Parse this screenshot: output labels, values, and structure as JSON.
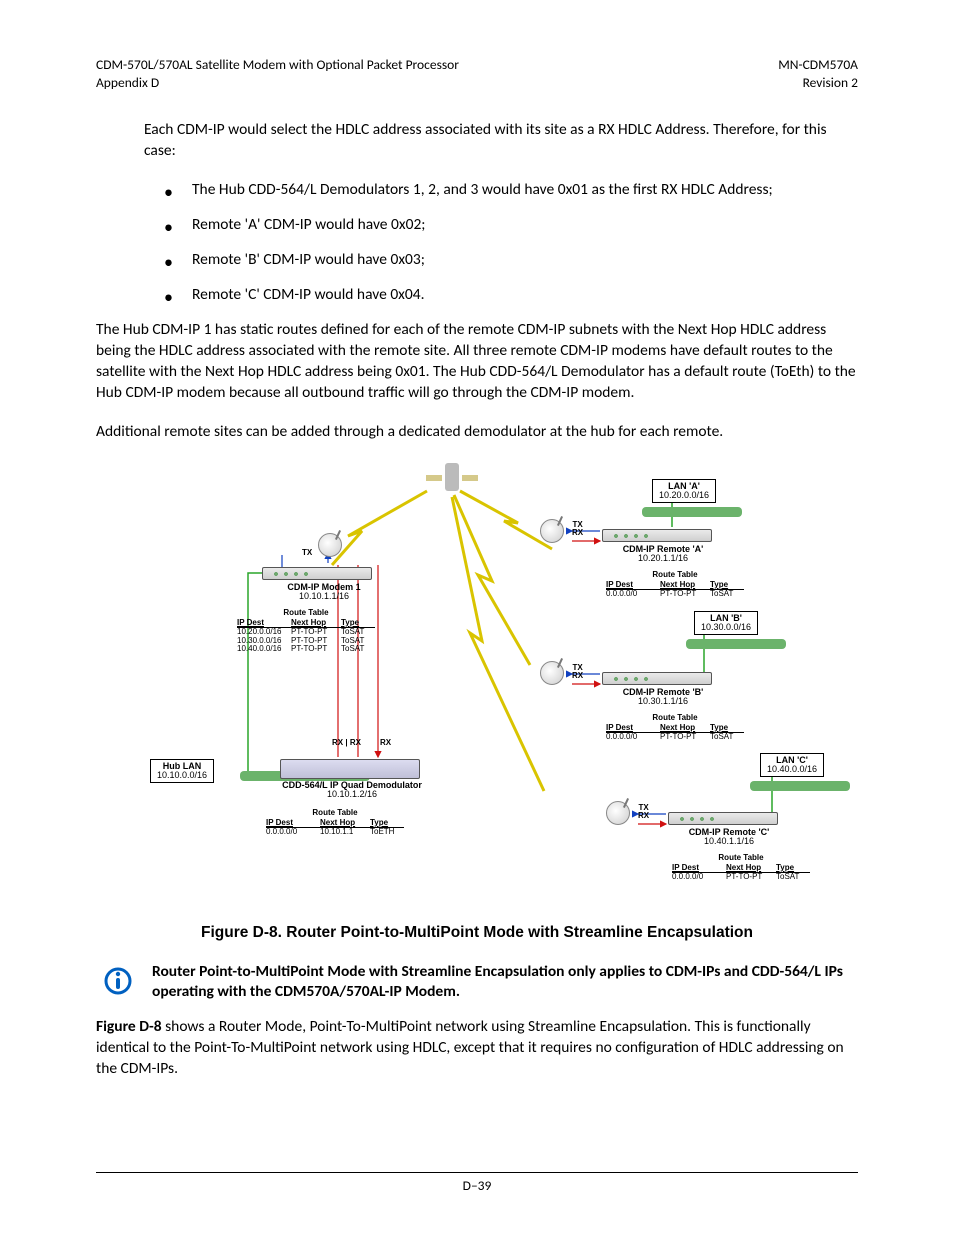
{
  "header": {
    "left1": "CDM-570L/570AL Satellite Modem with Optional Packet Processor",
    "left2": "Appendix D",
    "right1": "MN-CDM570A",
    "right2": "Revision 2"
  },
  "intro": "Each CDM-IP would select the HDLC address associated with its site as a RX HDLC Address. Therefore, for this case:",
  "bullets": [
    "The Hub CDD-564/L Demodulators 1, 2, and 3 would have 0x01 as the first RX HDLC Address;",
    "Remote 'A' CDM-IP would have 0x02;",
    "Remote 'B' CDM-IP would have 0x03;",
    "Remote 'C' CDM-IP would have 0x04."
  ],
  "para2": "The Hub CDM-IP 1 has static routes defined for each of the remote CDM-IP subnets with the Next Hop HDLC address being the HDLC address associated with the remote site. All three remote CDM-IP modems have default routes to the satellite with the Next Hop HDLC address being 0x01. The Hub CDD-564/L Demodulator has a default route (ToEth) to the Hub CDM-IP modem because all outbound traffic will go through the CDM-IP modem.",
  "para3": "Additional remote sites can be added through a dedicated demodulator at the hub for each remote.",
  "figure_caption": "Figure D-8. Router Point-to-MultiPoint Mode with Streamline Encapsulation",
  "note_text": "Router Point-to-MultiPoint Mode with Streamline Encapsulation only applies to CDM-IPs and CDD-564/L IPs operating with the CDM570A/570AL-IP Modem.",
  "para4_lead": "Figure D-8",
  "para4_rest": " shows a Router Mode, Point-To-MultiPoint network using Streamline Encapsulation. This is functionally identical to the Point-To-MultiPoint network using HDLC, except that it requires no configuration of HDLC addressing on the CDM-IPs.",
  "footer": "D–39",
  "diagram": {
    "hub_lan": {
      "title": "Hub LAN",
      "sub": "10.10.0.0/16"
    },
    "lan_a": {
      "title": "LAN 'A'",
      "sub": "10.20.0.0/16"
    },
    "lan_b": {
      "title": "LAN 'B'",
      "sub": "10.30.0.0/16"
    },
    "lan_c": {
      "title": "LAN 'C'",
      "sub": "10.40.0.0/16"
    },
    "hub_modem": {
      "title": "CDM-IP Modem 1",
      "sub": "10.10.1.1/16"
    },
    "hub_demod": {
      "title": "CDD-564/L IP Quad Demodulator",
      "sub": "10.10.1.2/16"
    },
    "remote_a": {
      "title": "CDM-IP Remote 'A'",
      "sub": "10.20.1.1/16"
    },
    "remote_b": {
      "title": "CDM-IP Remote 'B'",
      "sub": "10.30.1.1/16"
    },
    "remote_c": {
      "title": "CDM-IP Remote 'C'",
      "sub": "10.40.1.1/16"
    },
    "tx_label": "TX",
    "rx_label": "RX",
    "route_table_header": "Route Table",
    "rt_cols": {
      "c1": "IP Dest",
      "c2": "Next Hop",
      "c3": "Type"
    },
    "hub_modem_routes": [
      {
        "c1": "10.20.0.0/16",
        "c2": "PT-TO-PT",
        "c3": "ToSAT"
      },
      {
        "c1": "10.30.0.0/16",
        "c2": "PT-TO-PT",
        "c3": "ToSAT"
      },
      {
        "c1": "10.40.0.0/16",
        "c2": "PT-TO-PT",
        "c3": "ToSAT"
      }
    ],
    "hub_demod_routes": [
      {
        "c1": "0.0.0.0/0",
        "c2": "10.10.1.1",
        "c3": "ToETH"
      }
    ],
    "remote_routes": [
      {
        "c1": "0.0.0.0/0",
        "c2": "PT-TO-PT",
        "c3": "ToSAT"
      }
    ]
  }
}
